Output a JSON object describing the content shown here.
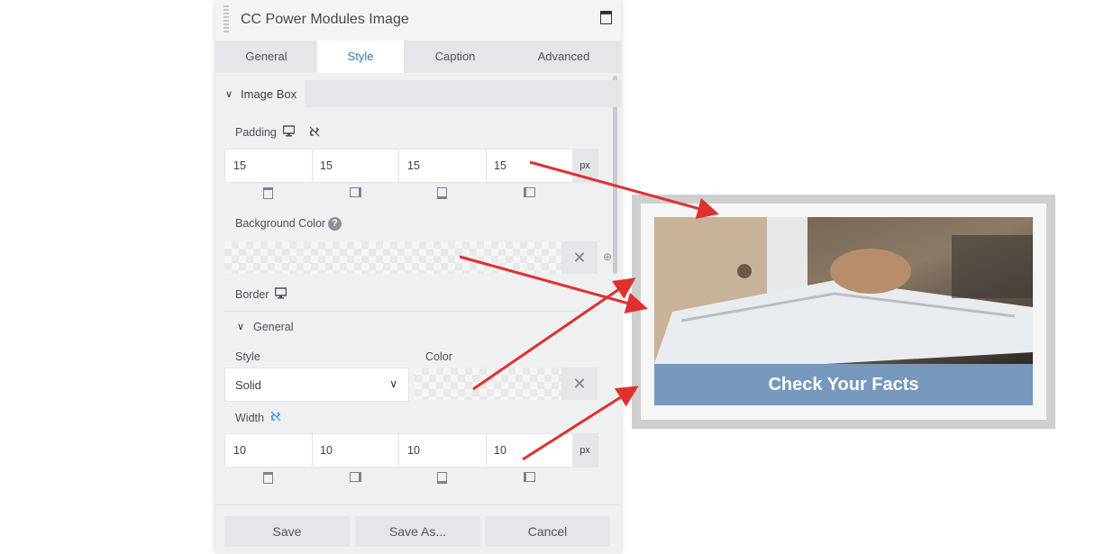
{
  "panel": {
    "title": "CC Power Modules Image",
    "tabs": [
      "General",
      "Style",
      "Caption",
      "Advanced"
    ],
    "active_tab": "Style",
    "section": {
      "label": "Image Box"
    },
    "padding": {
      "label": "Padding",
      "values": [
        "15",
        "15",
        "15",
        "15"
      ],
      "unit": "px"
    },
    "background_color": {
      "label": "Background Color",
      "help": "?"
    },
    "border": {
      "label": "Border",
      "subsection": "General",
      "style_label": "Style",
      "style_value": "Solid",
      "color_label": "Color",
      "width_label": "Width",
      "width_values": [
        "10",
        "10",
        "10",
        "10"
      ],
      "unit": "px"
    },
    "footer": {
      "save": "Save",
      "save_as": "Save As...",
      "cancel": "Cancel"
    }
  },
  "preview": {
    "caption": "Check Your Facts",
    "caption_bg": "#7698bd",
    "border_color": "#cfcfcf",
    "padding_bg": "#f6f6f6"
  },
  "accent": {
    "arrow": "#e03030",
    "tab_active": "#2b7bb9"
  }
}
